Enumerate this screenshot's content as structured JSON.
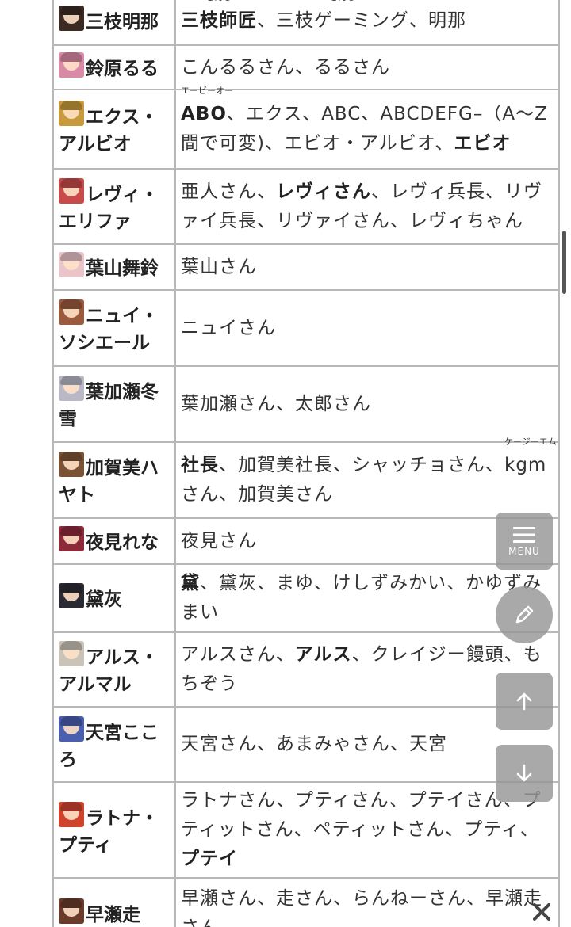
{
  "colors": {
    "border": "#b8b8b8",
    "fab_background": "#969696",
    "text": "#333333"
  },
  "rows": [
    {
      "name": "三枝明那",
      "avatar_color": "#3a2a22",
      "height": 62,
      "nickname_parts": [
        {
          "t": "三枝師匠",
          "b": true,
          "ruby": "さんし"
        },
        {
          "t": "、"
        },
        {
          "t": "三枝ゲーミング",
          "ruby": "さんし"
        },
        {
          "t": "、明那"
        }
      ]
    },
    {
      "name": "鈴原るる",
      "avatar_color": "#d98aa6",
      "height": 56,
      "nickname_parts": [
        {
          "t": "こんるるさん、るるさん"
        }
      ]
    },
    {
      "name": "エクス・アルビオ",
      "avatar_color": "#c79a3b",
      "height": 100,
      "nickname_parts": [
        {
          "t": "ABO",
          "b": true,
          "ruby": "エービーオー"
        },
        {
          "t": "、エクス、ABC、ABCDEFG–（A〜Z間で可変)、エビオ・アルビオ、"
        },
        {
          "t": "エビオ",
          "b": true
        }
      ]
    },
    {
      "name": "レヴィ・エリファ",
      "avatar_color": "#c84a4a",
      "height": 95,
      "nickname_parts": [
        {
          "t": "亜人さん、"
        },
        {
          "t": "レヴィさん",
          "b": true
        },
        {
          "t": "、レヴィ兵長、リヴァイ兵長、リヴァイさん、レヴィちゃん"
        }
      ]
    },
    {
      "name": "葉山舞鈴",
      "avatar_color": "#e9c4c8",
      "height": 58,
      "nickname_parts": [
        {
          "t": "葉山さん"
        }
      ]
    },
    {
      "name": "ニュイ・ソシエール",
      "avatar_color": "#9a5a3e",
      "height": 96,
      "nickname_parts": [
        {
          "t": "ニュイさん"
        }
      ]
    },
    {
      "name": "葉加瀬冬雪",
      "avatar_color": "#b9b9c6",
      "height": 96,
      "nickname_parts": [
        {
          "t": "葉加瀬さん、太郎さん"
        }
      ]
    },
    {
      "name": "加賀美ハヤト",
      "avatar_color": "#7a5236",
      "height": 96,
      "nickname_parts": [
        {
          "t": "社長",
          "b": true
        },
        {
          "t": "、加賀美社長、シャッチョさん、"
        },
        {
          "t": "kgm",
          "ruby": "ケージーエム"
        },
        {
          "t": "さん、加賀美さん"
        }
      ]
    },
    {
      "name": "夜見れな",
      "avatar_color": "#8c2a3a",
      "height": 58,
      "nickname_parts": [
        {
          "t": "夜見さん"
        }
      ]
    },
    {
      "name": "黛灰",
      "avatar_color": "#2a2a33",
      "height": 86,
      "nickname_parts": [
        {
          "t": "黛",
          "b": true
        },
        {
          "t": "、黛灰、まゆ、けしずみかい、かゆずみまい"
        }
      ]
    },
    {
      "name": "アルス・アルマル",
      "avatar_color": "#c9c3b8",
      "height": 94,
      "nickname_parts": [
        {
          "t": "アルスさん、"
        },
        {
          "t": "アルス",
          "b": true
        },
        {
          "t": "、クレイジー饅頭、もちぞう"
        }
      ]
    },
    {
      "name": "天宮こころ",
      "avatar_color": "#4a5fb0",
      "height": 95,
      "nickname_parts": [
        {
          "t": "天宮さん、あまみゃさん、天宮"
        }
      ]
    },
    {
      "name": "ラトナ・プティ",
      "avatar_color": "#d0442e",
      "height": 121,
      "nickname_parts": [
        {
          "t": "ラトナさん、プティさん、プテイさん、プティットさん、ペティットさん、プティ、"
        },
        {
          "t": "プテイ",
          "b": true
        }
      ]
    },
    {
      "name": "早瀬走",
      "avatar_color": "#6a3a2a",
      "height": 90,
      "nickname_parts": [
        {
          "t": "早瀬さん、走さん、らんねーさん、早瀬走さん"
        }
      ]
    }
  ],
  "fab": {
    "menu_label": "MENU",
    "menu_icon": "hamburger-icon",
    "edit_icon": "pencil-icon",
    "up_icon": "arrow-up-icon",
    "down_icon": "arrow-down-icon",
    "close_icon": "close-icon"
  }
}
